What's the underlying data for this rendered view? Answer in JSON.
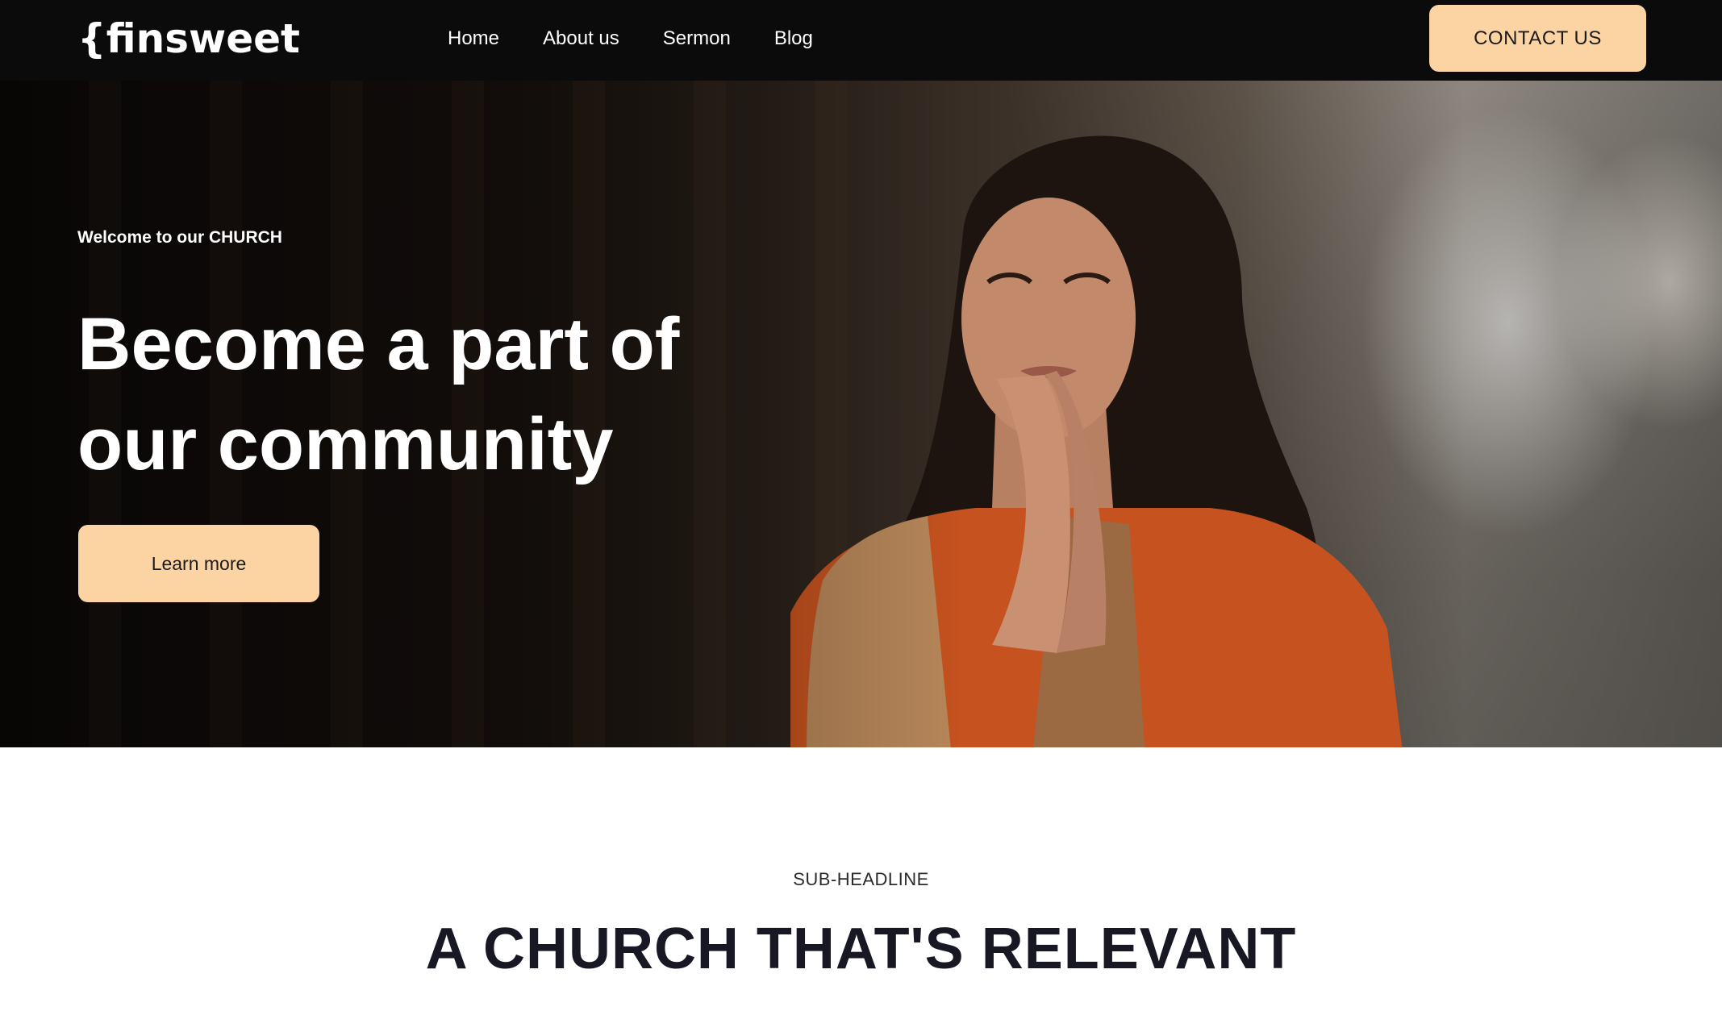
{
  "brand": {
    "logo_text": "{finsweet"
  },
  "nav": {
    "links": [
      {
        "label": "Home"
      },
      {
        "label": "About us"
      },
      {
        "label": "Sermon"
      },
      {
        "label": "Blog"
      }
    ],
    "cta_label": "CONTACT US"
  },
  "hero": {
    "eyebrow": "Welcome to our CHURCH",
    "title": "Become a part of our community",
    "button_label": "Learn more",
    "image_icon": "praying-woman-photo"
  },
  "section": {
    "sub_headline": "SUB-HEADLINE",
    "title": "A CHURCH THAT'S RELEVANT"
  },
  "colors": {
    "nav_background": "#0b0b0b",
    "accent": "#fcd4a3",
    "heading_dark": "#181824"
  }
}
